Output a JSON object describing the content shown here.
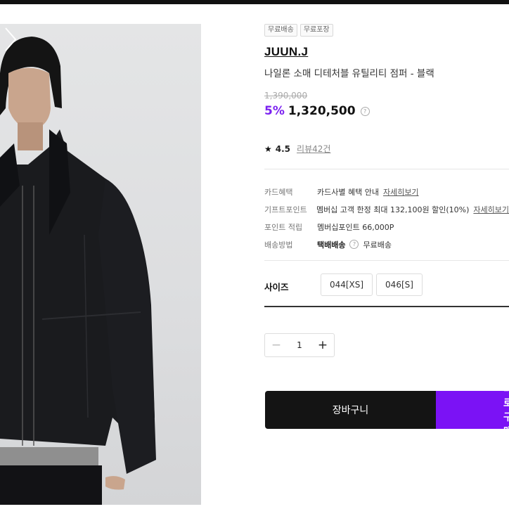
{
  "product": {
    "badges": [
      "무료배송",
      "무료포장"
    ],
    "brand": "JUUN.J",
    "name": "나일론 소매 디테처블 유틸리티 점퍼 - 블랙",
    "original_price": "1,390,000",
    "discount": "5%",
    "price": "1,320,500",
    "rating": "4.5",
    "reviews": "리뷰42건"
  },
  "info": {
    "card_label": "카드혜택",
    "card_value": "카드사별 혜택 안내",
    "card_link": "자세히보기",
    "gift_label": "기프트포인트",
    "gift_value": "멤버십 고객 한정 최대 132,100원 할인(10%)",
    "gift_link": "자세히보기",
    "point_label": "포인트 적립",
    "point_value": "멤버십포인트 66,000P",
    "ship_label": "배송방법",
    "ship_method": "택배배송",
    "ship_fee": "무료배송"
  },
  "size": {
    "label": "사이즈",
    "options": [
      "044[XS]",
      "046[S]"
    ]
  },
  "quantity": {
    "value": "1",
    "minus": "−",
    "plus": "+"
  },
  "actions": {
    "cart": "장바구니",
    "buy": "바로구매"
  },
  "icons": {
    "star": "star-icon",
    "info": "info-icon",
    "next": "chevron-right-icon"
  },
  "colors": {
    "accent": "#7b12f5",
    "discount": "#7b21f0",
    "cart": "#141414"
  }
}
